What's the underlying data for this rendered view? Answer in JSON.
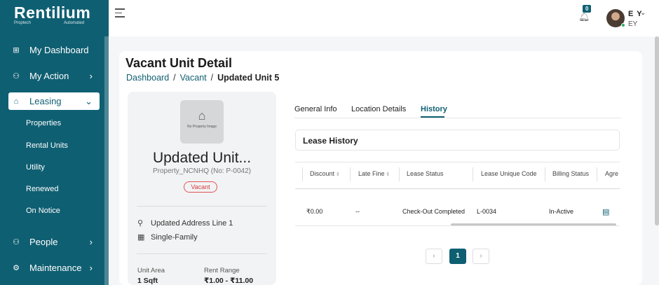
{
  "brand": {
    "name": "Rentilium",
    "tag_left": "Proptech",
    "tag_right": "Automated"
  },
  "sidebar": {
    "items": [
      {
        "label": "My Dashboard",
        "icon": "grid-icon"
      },
      {
        "label": "My Action",
        "icon": "user-action-icon"
      },
      {
        "label": "Leasing",
        "icon": "lease-icon"
      },
      {
        "label": "People",
        "icon": "people-icon"
      },
      {
        "label": "Maintenance",
        "icon": "tools-icon"
      }
    ],
    "leasing_sub": [
      "Properties",
      "Rental Units",
      "Utility",
      "Renewed",
      "On Notice"
    ]
  },
  "header": {
    "notification_count": "0",
    "user_initials": "E Y",
    "user_sub": "EY"
  },
  "page": {
    "title": "Vacant Unit Detail",
    "breadcrumb": [
      "Dashboard",
      "Vacant",
      "Updated Unit 5"
    ],
    "separator": "/"
  },
  "unit": {
    "image_placeholder": "No Property Image",
    "name": "Updated Unit...",
    "property_code": "Property_NCNHQ (No: P-0042)",
    "status": "Vacant",
    "address": "Updated Address Line 1",
    "type": "Single-Family",
    "area_label": "Unit Area",
    "area_value": "1 Sqft",
    "rent_label": "Rent Range",
    "rent_value": "₹1.00 - ₹11.00"
  },
  "tabs": [
    "General Info",
    "Location Details",
    "History"
  ],
  "active_tab": "History",
  "lease_history": {
    "title": "Lease History",
    "columns": [
      "Discount",
      "Late Fine",
      "Lease Status",
      "Lease Unique Code",
      "Billing Status",
      "Agre"
    ],
    "rows": [
      {
        "discount": "₹0.00",
        "late_fine": "--",
        "lease_status": "Check-Out Completed",
        "code": "L-0034",
        "billing": "In-Active",
        "agreement_icon": "document-icon"
      }
    ]
  },
  "pagination": {
    "prev": "‹",
    "current": "1",
    "next": "›"
  },
  "colors": {
    "primary": "#0f5f72",
    "danger": "#d63d3d"
  }
}
